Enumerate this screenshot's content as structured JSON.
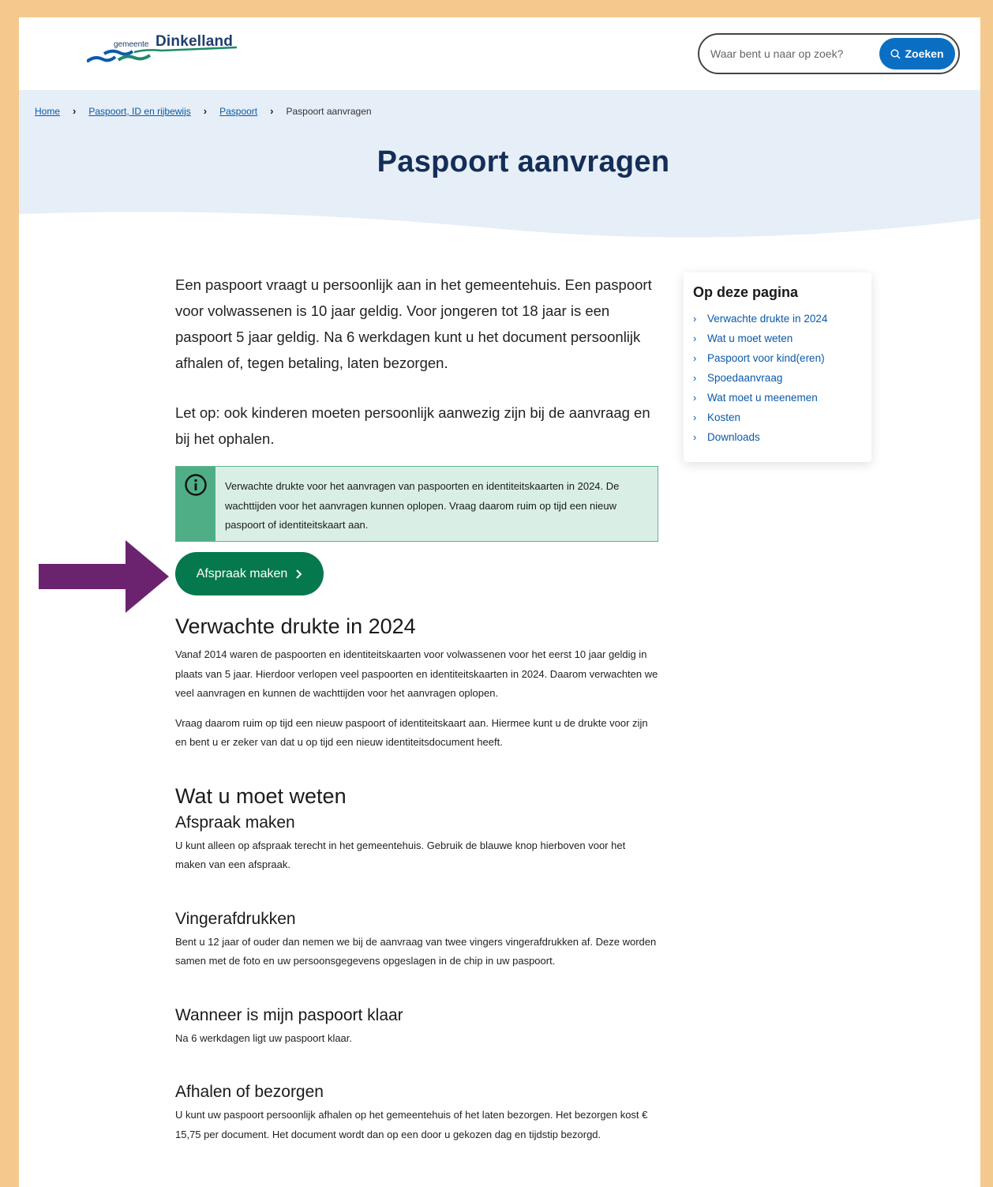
{
  "header": {
    "logo_small": "gemeente",
    "logo_big": "Dinkelland",
    "search_placeholder": "Waar bent u naar op zoek?",
    "search_button": "Zoeken"
  },
  "breadcrumb": [
    "Home",
    "Paspoort, ID en rijbewijs",
    "Paspoort",
    "Paspoort aanvragen"
  ],
  "page_title": "Paspoort aanvragen",
  "intro": {
    "p1": "Een paspoort vraagt u persoonlijk aan in het gemeentehuis. Een paspoort voor volwassenen is 10 jaar geldig. Voor jongeren tot 18 jaar is een paspoort 5 jaar geldig. Na 6 werkdagen kunt u het document persoonlijk afhalen of, tegen betaling, laten bezorgen.",
    "p2": "Let op: ook kinderen moeten persoonlijk aanwezig zijn bij de aanvraag en bij het ophalen."
  },
  "notice": "Verwachte drukte voor het aanvragen van paspoorten en identiteitskaarten in 2024. De wachttijden voor het aanvragen kunnen oplopen. Vraag daarom ruim op tijd een nieuw paspoort of identiteitskaart aan.",
  "cta_label": "Afspraak maken",
  "sections": {
    "drukte_title": "Verwachte drukte in 2024",
    "drukte_p1": "Vanaf 2014 waren de paspoorten en identiteitskaarten voor volwassenen voor het eerst 10 jaar geldig in plaats van 5 jaar. Hierdoor verlopen veel paspoorten en identiteitskaarten in 2024. Daarom verwachten we veel aanvragen en kunnen de wachttijden voor het aanvragen oplopen.",
    "drukte_p2": "Vraag daarom ruim op tijd een nieuw paspoort of identiteitskaart aan. Hiermee kunt u de drukte voor zijn en bent u er zeker van dat u op tijd een nieuw identiteitsdocument heeft.",
    "weten_title": "Wat u moet weten",
    "afspraak_title": "Afspraak maken",
    "afspraak_p": "U kunt alleen op afspraak terecht in het gemeentehuis. Gebruik de blauwe knop hierboven voor het maken van een afspraak.",
    "vinger_title": "Vingerafdrukken",
    "vinger_p": "Bent u 12 jaar of ouder dan nemen we bij de aanvraag van twee vingers vingerafdrukken af. Deze worden samen met de foto en uw persoonsgegevens opgeslagen in de chip in uw paspoort.",
    "klaar_title": "Wanneer is mijn paspoort klaar",
    "klaar_p": "Na 6 werkdagen ligt uw paspoort klaar.",
    "afhalen_title": "Afhalen of bezorgen",
    "afhalen_p": "U kunt uw paspoort persoonlijk afhalen op het gemeentehuis of het laten bezorgen. Het bezorgen kost € 15,75 per document. Het document wordt dan op een door u gekozen dag en tijdstip bezorgd."
  },
  "toc": {
    "title": "Op deze pagina",
    "items": [
      "Verwachte drukte in 2024",
      "Wat u moet weten",
      "Paspoort voor kind(eren)",
      "Spoedaanvraag",
      "Wat moet u meenemen",
      "Kosten",
      "Downloads"
    ]
  },
  "colors": {
    "brand_navy": "#142e58",
    "link_blue": "#0a5aa8",
    "button_blue": "#0a6fc2",
    "cta_green": "#06784e",
    "notice_bg": "#d9efe5",
    "annotation_arrow": "#6b2370",
    "frame": "#f5c98e"
  }
}
